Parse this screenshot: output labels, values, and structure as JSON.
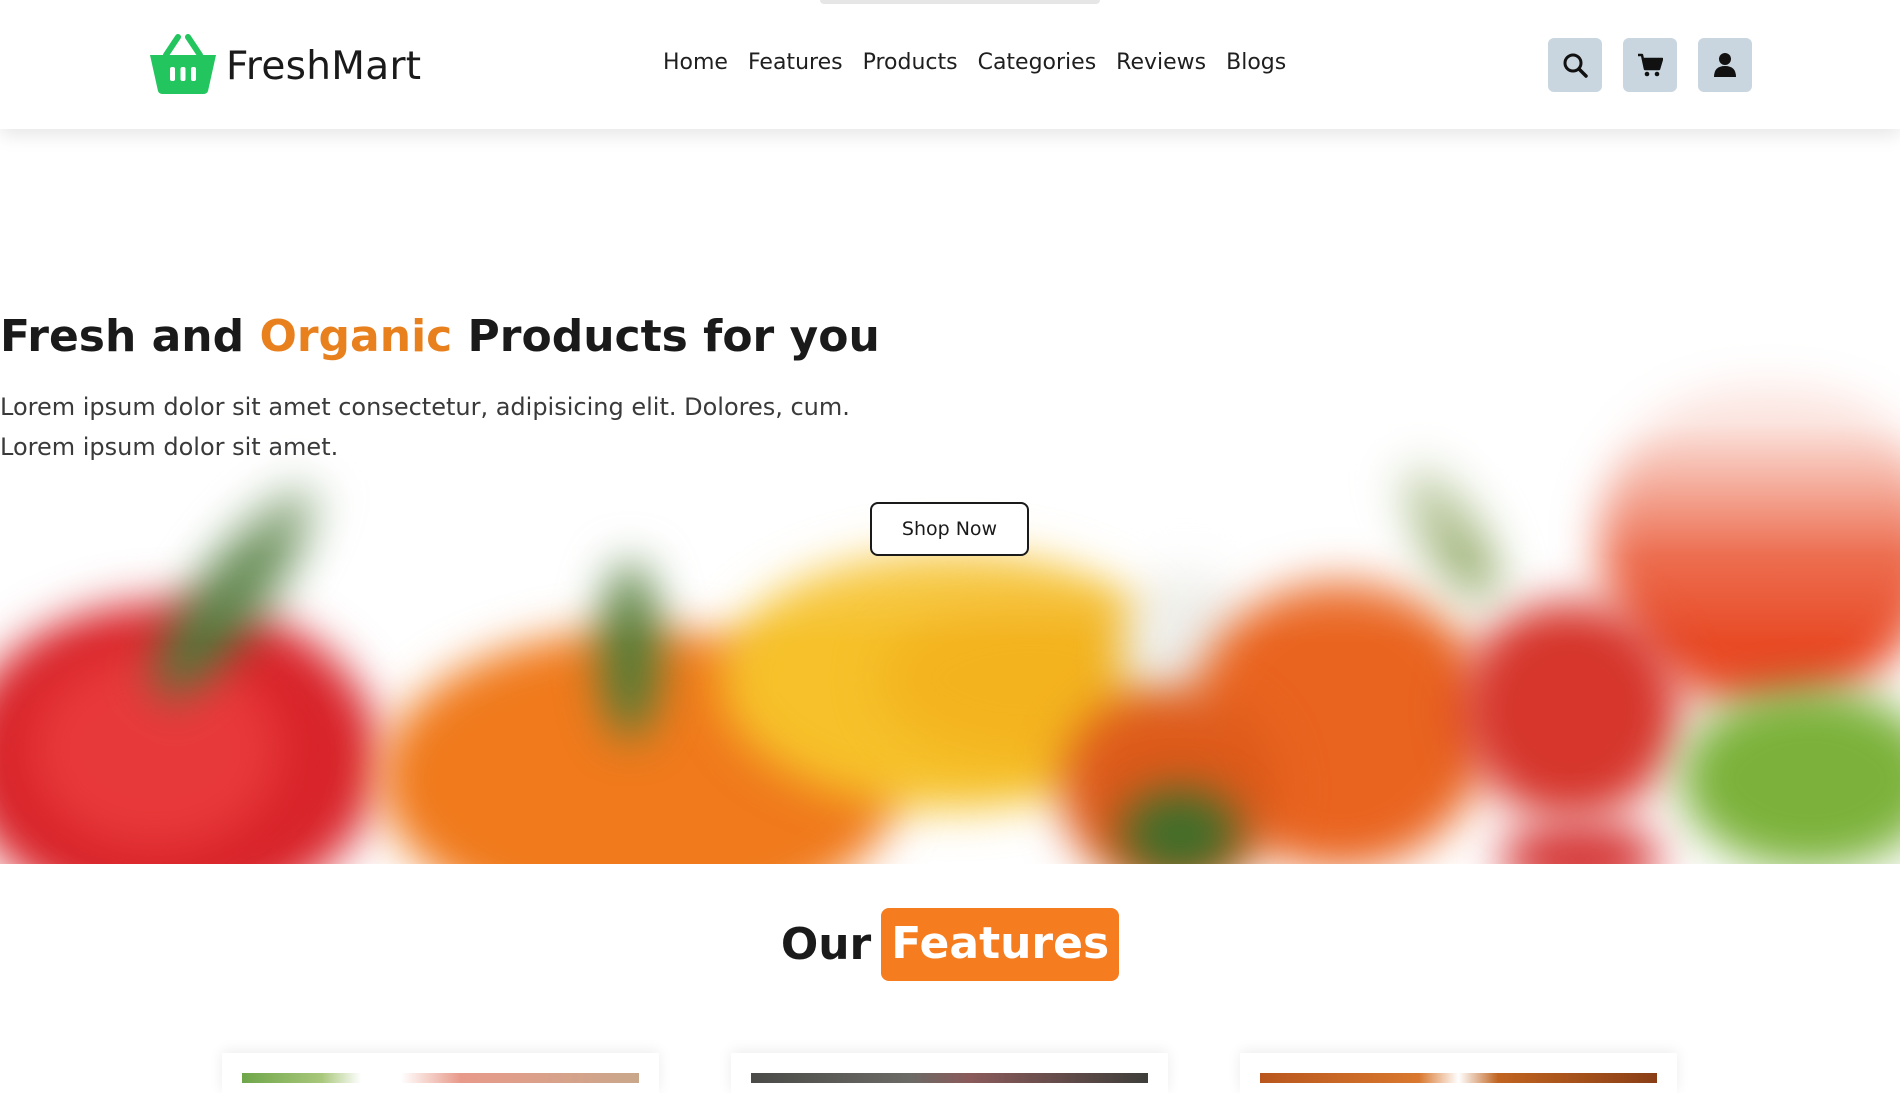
{
  "brand": {
    "name": "FreshMart",
    "logo_icon": "basket-icon",
    "accent_color": "#22c55e"
  },
  "nav": {
    "items": [
      "Home",
      "Features",
      "Products",
      "Categories",
      "Reviews",
      "Blogs"
    ]
  },
  "header_icons": {
    "search": "search-icon",
    "cart": "cart-icon",
    "user": "user-icon",
    "button_color": "#c9d6df"
  },
  "hero": {
    "title_prefix": "Fresh and ",
    "title_accent": "Organic",
    "title_suffix": " Products for you",
    "subtitle_line1": "Lorem ipsum dolor sit amet consectetur, adipisicing elit. Dolores, cum.",
    "subtitle_line2": "Lorem ipsum dolor sit amet.",
    "cta_label": "Shop Now",
    "accent_color": "#e8801e"
  },
  "features": {
    "title_plain": "Our",
    "title_badge": "Features",
    "badge_color": "#f57c1f"
  }
}
